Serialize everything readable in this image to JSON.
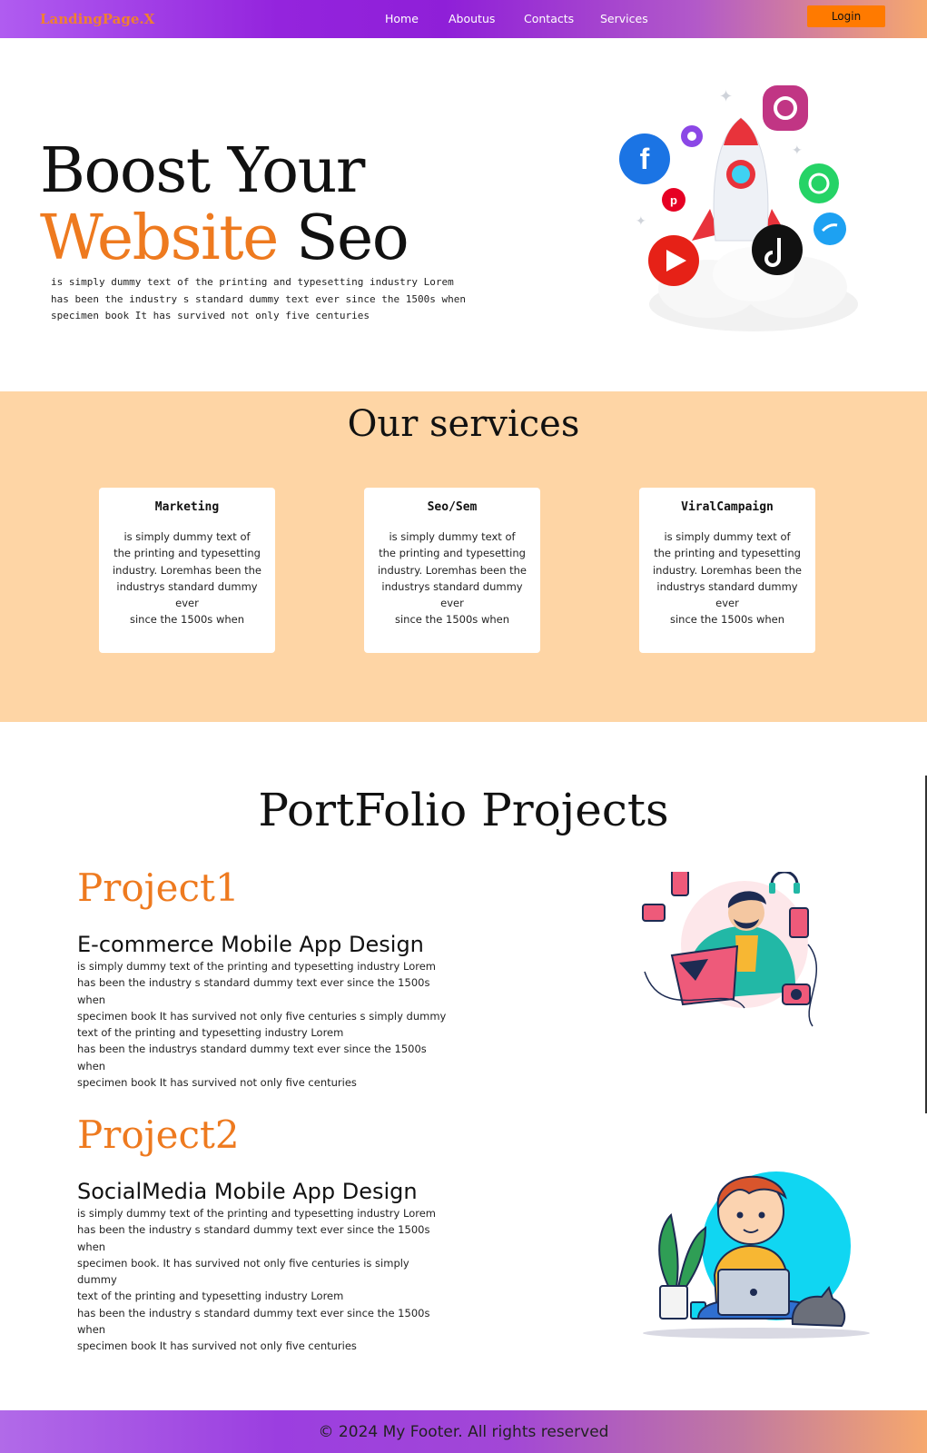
{
  "nav": {
    "brand": "LandingPage.X",
    "links": [
      "Home",
      "Aboutus",
      "Contacts",
      "Services"
    ],
    "login": "Login"
  },
  "hero": {
    "line1": "Boost Your",
    "accent": "Website",
    "rest": "Seo",
    "desc_lines": [
      "is simply dummy text of the printing and typesetting industry Lorem",
      "has been the industry s standard dummy text ever since the 1500s when",
      "specimen book It has survived not only five centuries"
    ]
  },
  "services": {
    "title": "Our services",
    "cards": [
      {
        "title": "Marketing",
        "lines": [
          "is simply dummy text of",
          "the printing and typesetting",
          "industry. Loremhas been the",
          "industrys standard dummy ever",
          "since the 1500s when"
        ]
      },
      {
        "title": "Seo/Sem",
        "lines": [
          "is simply dummy text of",
          "the printing and typesetting",
          "industry. Loremhas been the",
          "industrys standard dummy ever",
          "since the 1500s when"
        ]
      },
      {
        "title": "ViralCampaign",
        "lines": [
          "is simply dummy text of",
          "the printing and typesetting",
          "industry. Loremhas been the",
          "industrys standard dummy ever",
          "since the 1500s when"
        ]
      }
    ]
  },
  "portfolio": {
    "title": "PortFolio Projects",
    "projects": [
      {
        "label": "Project1",
        "name": "E-commerce Mobile App Design",
        "lines": [
          "is simply dummy text of the printing and typesetting industry Lorem",
          "has been the industry s standard dummy text ever since the 1500s when",
          "specimen book It has survived not only five centuries s simply dummy",
          "text of the printing and typesetting industry Lorem",
          "has been the industrys standard dummy text ever since the 1500s when",
          "specimen book It has survived not only five centuries"
        ]
      },
      {
        "label": "Project2",
        "name": "SocialMedia Mobile App Design",
        "lines": [
          "is simply dummy text of the printing and typesetting industry Lorem",
          "has been the industry s standard dummy text ever since the 1500s when",
          "specimen book. It has survived not only five centuries is simply dummy",
          "text of the printing and typesetting industry Lorem",
          "has been the industry s standard dummy text ever since the 1500s when",
          "specimen book It has survived not only five centuries"
        ]
      }
    ]
  },
  "footer": {
    "text": "© 2024 My Footer. All rights reserved"
  }
}
